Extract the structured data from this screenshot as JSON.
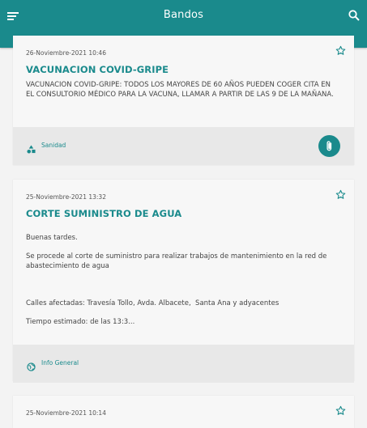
{
  "appbar": {
    "title": "Bandos"
  },
  "cards": [
    {
      "date": "26-Noviembre-2021 10:46",
      "headline": "VACUNACION COVID-GRIPE",
      "body": "VACUNACION COVID-GRIPE: TODOS LOS MAYORES DE 60 AÑOS PUEDEN COGER CITA EN EL CONSULTORIO MÉDICO PARA LA VACUNA, LLAMAR A PARTIR DE LAS 9 DE LA MAÑANA.",
      "category": "Sanidad",
      "category_icon": "shapes-icon",
      "has_attachment": true
    },
    {
      "date": "25-Noviembre-2021 13:32",
      "headline": "CORTE SUMINISTRO DE AGUA",
      "body": "Buenas tardes.\n\nSe procede al corte de suministro para realizar trabajos de mantenimiento en la red de abastecimiento de agua\n\n\n\nCalles afectadas: Travesía Tollo, Avda. Albacete,  Santa Ana y adyacentes\n\nTiempo estimado: de las 13:3...",
      "category": "Info General",
      "category_icon": "globe-icon",
      "has_attachment": false
    },
    {
      "date": "25-Noviembre-2021 10:14"
    }
  ],
  "colors": {
    "primary": "#1a8a8c",
    "background": "#f3f3f3",
    "card": "#f7f7f7",
    "card_footer": "#e8e8e8"
  }
}
